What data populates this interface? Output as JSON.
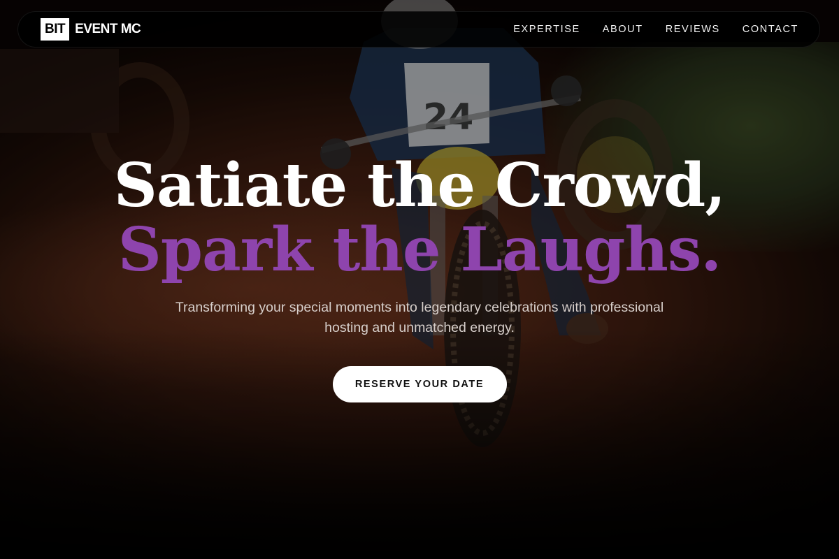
{
  "brand": {
    "box_text": "BIT",
    "name": "EVENT MC"
  },
  "nav": {
    "links": [
      {
        "label": "EXPERTISE"
      },
      {
        "label": "ABOUT"
      },
      {
        "label": "REVIEWS"
      },
      {
        "label": "CONTACT"
      }
    ]
  },
  "hero": {
    "headline_line1": "Satiate the Crowd,",
    "headline_line2": "Spark the Laughs.",
    "subtitle": "Transforming your special moments into legendary celebrations with professional hosting and unmatched energy.",
    "cta_label": "RESERVE YOUR DATE",
    "background_image": "motocross-rider-24-icon"
  },
  "colors": {
    "accent_purple": "#8e44ad",
    "nav_bg": "#000000",
    "cta_bg": "#ffffff"
  }
}
